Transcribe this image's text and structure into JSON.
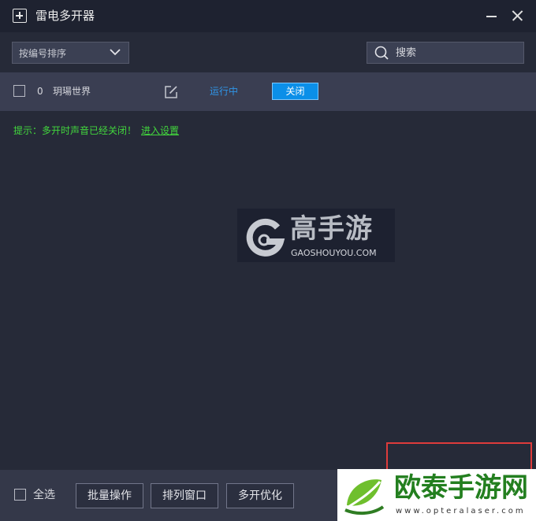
{
  "window": {
    "title": "雷电多开器"
  },
  "toolbar": {
    "sort_label": "按编号排序",
    "search_placeholder": "搜索"
  },
  "instances": [
    {
      "index": "0",
      "name": "玥瑒世界",
      "status": "运行中",
      "action_label": "关闭"
    }
  ],
  "hint": {
    "text": "提示：多开时声音已经关闭！",
    "link": "进入设置"
  },
  "footer": {
    "select_all_label": "全选",
    "buttons": [
      "批量操作",
      "排列窗口",
      "多开优化"
    ]
  },
  "watermark": {
    "name_cn": "高手游",
    "domain": "GAOSHOUYOU.COM"
  },
  "brand": {
    "name_cn": "欧泰手游网",
    "domain": "www.opteralaser.com"
  },
  "colors": {
    "accent": "#0b8fe8",
    "status_running": "#2f95e8",
    "hint_green": "#42d63d",
    "highlight_frame": "#de3b3b"
  }
}
